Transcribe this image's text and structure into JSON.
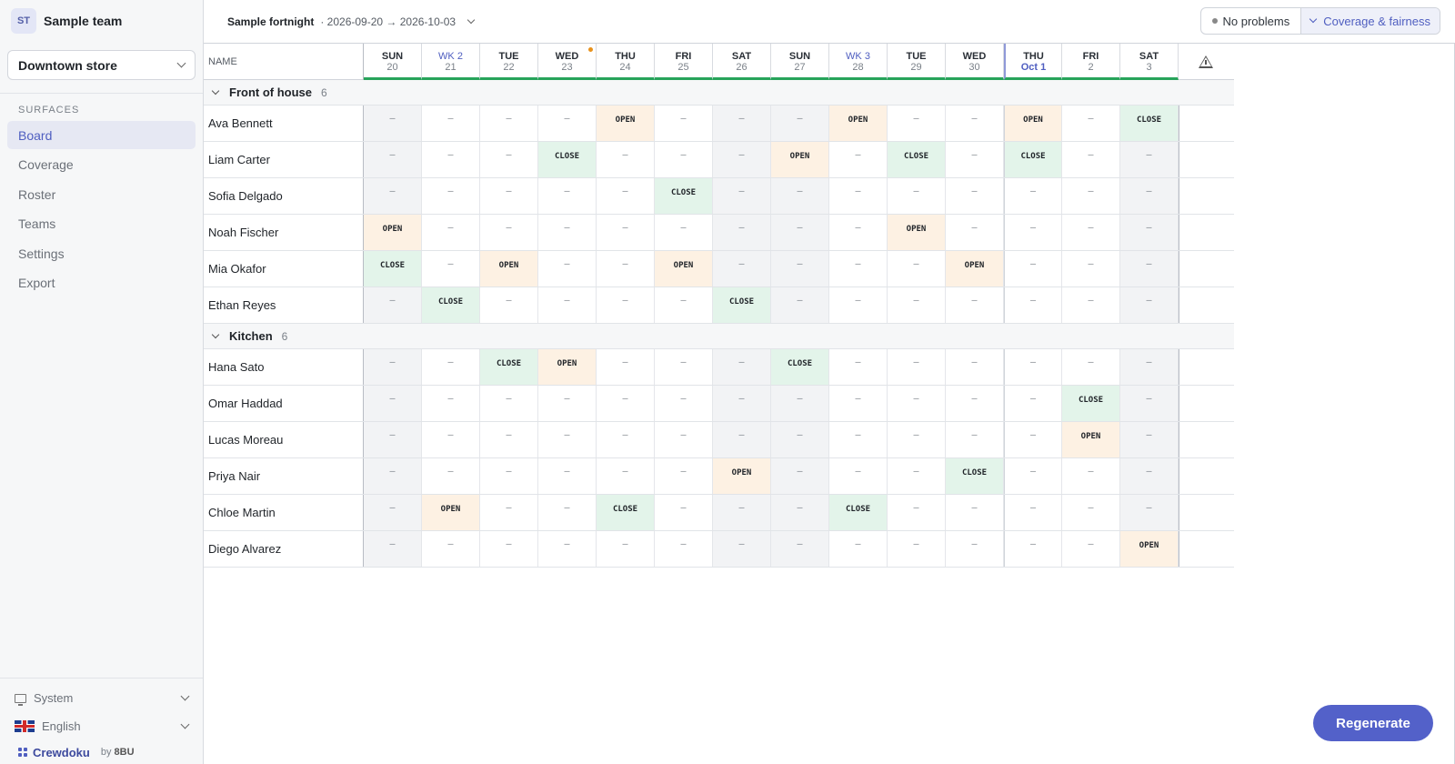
{
  "team": {
    "initials": "ST",
    "name": "Sample team"
  },
  "store_select": {
    "value": "Downtown store"
  },
  "nav": {
    "section_label": "SURFACES",
    "items": [
      {
        "label": "Board",
        "active": true
      },
      {
        "label": "Coverage",
        "active": false
      },
      {
        "label": "Roster",
        "active": false
      },
      {
        "label": "Teams",
        "active": false
      },
      {
        "label": "Settings",
        "active": false
      },
      {
        "label": "Export",
        "active": false
      }
    ]
  },
  "footer": {
    "theme_label": "System",
    "language_label": "English",
    "brand_name": "Crewdoku",
    "brand_by": "by",
    "brand_org": "8BU"
  },
  "topbar": {
    "period_name": "Sample fortnight",
    "period_range": "· 2026-09-20 → 2026-10-03",
    "status_label": "No problems",
    "coverage_label": "Coverage & fairness"
  },
  "board": {
    "name_header": "NAME",
    "days": [
      {
        "name": "SUN",
        "num": "20",
        "week": false,
        "today": false,
        "weekend": true,
        "marker": false
      },
      {
        "name": "WK 2",
        "num": "21",
        "week": true,
        "today": false,
        "weekend": false,
        "marker": false
      },
      {
        "name": "TUE",
        "num": "22",
        "week": false,
        "today": false,
        "weekend": false,
        "marker": false
      },
      {
        "name": "WED",
        "num": "23",
        "week": false,
        "today": false,
        "weekend": false,
        "marker": true
      },
      {
        "name": "THU",
        "num": "24",
        "week": false,
        "today": false,
        "weekend": false,
        "marker": false
      },
      {
        "name": "FRI",
        "num": "25",
        "week": false,
        "today": false,
        "weekend": false,
        "marker": false
      },
      {
        "name": "SAT",
        "num": "26",
        "week": false,
        "today": false,
        "weekend": true,
        "marker": false
      },
      {
        "name": "SUN",
        "num": "27",
        "week": false,
        "today": false,
        "weekend": true,
        "marker": false
      },
      {
        "name": "WK 3",
        "num": "28",
        "week": true,
        "today": false,
        "weekend": false,
        "marker": false
      },
      {
        "name": "TUE",
        "num": "29",
        "week": false,
        "today": false,
        "weekend": false,
        "marker": false
      },
      {
        "name": "WED",
        "num": "30",
        "week": false,
        "today": false,
        "weekend": false,
        "marker": false
      },
      {
        "name": "THU",
        "num": "Oct 1",
        "week": false,
        "today": true,
        "weekend": false,
        "marker": false
      },
      {
        "name": "FRI",
        "num": "2",
        "week": false,
        "today": false,
        "weekend": false,
        "marker": false
      },
      {
        "name": "SAT",
        "num": "3",
        "week": false,
        "today": false,
        "weekend": true,
        "marker": false
      }
    ],
    "empty_mark": "–",
    "groups": [
      {
        "name": "Front of house",
        "count": "6",
        "staff": [
          {
            "name": "Ava Bennett",
            "shifts": [
              "",
              "",
              "",
              "",
              "OPEN",
              "",
              "",
              "",
              "OPEN",
              "",
              "",
              "OPEN",
              "",
              "CLOSE"
            ]
          },
          {
            "name": "Liam Carter",
            "shifts": [
              "",
              "",
              "",
              "CLOSE",
              "",
              "",
              "",
              "OPEN",
              "",
              "CLOSE",
              "",
              "CLOSE",
              "",
              ""
            ]
          },
          {
            "name": "Sofia Delgado",
            "shifts": [
              "",
              "",
              "",
              "",
              "",
              "CLOSE",
              "",
              "",
              "",
              "",
              "",
              "",
              "",
              ""
            ]
          },
          {
            "name": "Noah Fischer",
            "shifts": [
              "OPEN",
              "",
              "",
              "",
              "",
              "",
              "",
              "",
              "",
              "OPEN",
              "",
              "",
              "",
              ""
            ]
          },
          {
            "name": "Mia Okafor",
            "shifts": [
              "CLOSE",
              "",
              "OPEN",
              "",
              "",
              "OPEN",
              "",
              "",
              "",
              "",
              "OPEN",
              "",
              "",
              ""
            ]
          },
          {
            "name": "Ethan Reyes",
            "shifts": [
              "",
              "CLOSE",
              "",
              "",
              "",
              "",
              "CLOSE",
              "",
              "",
              "",
              "",
              "",
              "",
              ""
            ]
          }
        ]
      },
      {
        "name": "Kitchen",
        "count": "6",
        "staff": [
          {
            "name": "Hana Sato",
            "shifts": [
              "",
              "",
              "CLOSE",
              "OPEN",
              "",
              "",
              "",
              "CLOSE",
              "",
              "",
              "",
              "",
              "",
              ""
            ]
          },
          {
            "name": "Omar Haddad",
            "shifts": [
              "",
              "",
              "",
              "",
              "",
              "",
              "",
              "",
              "",
              "",
              "",
              "",
              "CLOSE",
              ""
            ]
          },
          {
            "name": "Lucas Moreau",
            "shifts": [
              "",
              "",
              "",
              "",
              "",
              "",
              "",
              "",
              "",
              "",
              "",
              "",
              "OPEN",
              ""
            ]
          },
          {
            "name": "Priya Nair",
            "shifts": [
              "",
              "",
              "",
              "",
              "",
              "",
              "OPEN",
              "",
              "",
              "",
              "CLOSE",
              "",
              "",
              ""
            ]
          },
          {
            "name": "Chloe Martin",
            "shifts": [
              "",
              "OPEN",
              "",
              "",
              "CLOSE",
              "",
              "",
              "",
              "CLOSE",
              "",
              "",
              "",
              "",
              ""
            ]
          },
          {
            "name": "Diego Alvarez",
            "shifts": [
              "",
              "",
              "",
              "",
              "",
              "",
              "",
              "",
              "",
              "",
              "",
              "",
              "",
              "OPEN"
            ]
          }
        ]
      }
    ]
  },
  "regenerate_label": "Regenerate",
  "colors": {
    "accent": "#5361c9",
    "open_bg": "#fdf1e3",
    "close_bg": "#e3f4ea",
    "coverage_ok": "#27a35a"
  }
}
